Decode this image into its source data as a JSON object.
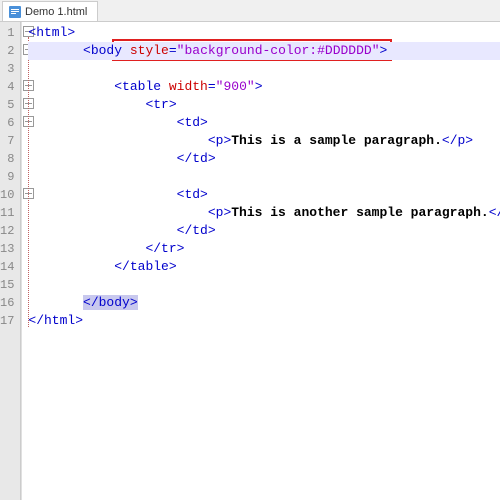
{
  "tab": {
    "filename": "Demo 1.html"
  },
  "lines": {
    "l1": {
      "num": "1",
      "tag_open": "<html>"
    },
    "l2": {
      "num": "2",
      "body_open": "<body",
      "attr_name": "style",
      "eq": "=",
      "q1": "\"",
      "attr_val": "background-color:#DDDDDD",
      "q2": "\"",
      "close": ">"
    },
    "l3": {
      "num": "3"
    },
    "l4": {
      "num": "4",
      "tag_open": "<table ",
      "attr_name": "width",
      "eq": "=",
      "val": "\"900\"",
      "close": ">"
    },
    "l5": {
      "num": "5",
      "tag": "<tr>"
    },
    "l6": {
      "num": "6",
      "tag": "<td>"
    },
    "l7": {
      "num": "7",
      "p_open": "<p>",
      "text": "This is a sample paragraph.",
      "p_close": "</p>"
    },
    "l8": {
      "num": "8",
      "tag": "</td>"
    },
    "l9": {
      "num": "9"
    },
    "l10": {
      "num": "10",
      "tag": "<td>"
    },
    "l11": {
      "num": "11",
      "p_open": "<p>",
      "text": "This is another sample paragraph.",
      "p_close": "</p"
    },
    "l12": {
      "num": "12",
      "tag": "</td>"
    },
    "l13": {
      "num": "13",
      "tag": "</tr>"
    },
    "l14": {
      "num": "14",
      "tag": "</table>"
    },
    "l15": {
      "num": "15"
    },
    "l16": {
      "num": "16",
      "tag": "</body>"
    },
    "l17": {
      "num": "17",
      "tag": "</html>"
    }
  }
}
